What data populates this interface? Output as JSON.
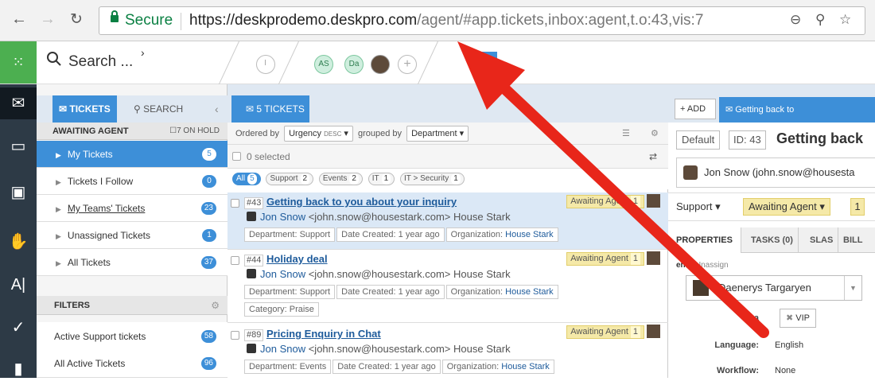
{
  "browser": {
    "secure_label": "Secure",
    "url_host": "https://deskprodemo.deskpro.com",
    "url_path": "/agent/#app.tickets,inbox:agent,t.o:43,vis:7"
  },
  "appbar": {
    "search_label": "Search ...",
    "avatars": [
      "AS",
      "Da"
    ]
  },
  "sidebar": {
    "tab_tickets": "TICKETS",
    "tab_search": "SEARCH",
    "awaiting_header": "AWAITING AGENT",
    "on_hold": "7 ON HOLD",
    "items": [
      {
        "label": "My Tickets",
        "count": "5",
        "selected": true
      },
      {
        "label": "Tickets I Follow",
        "count": "0"
      },
      {
        "label": "My Teams' Tickets",
        "count": "23"
      },
      {
        "label": "Unassigned Tickets",
        "count": "1"
      },
      {
        "label": "All Tickets",
        "count": "37"
      }
    ],
    "filters_header": "FILTERS",
    "filters": [
      {
        "label": "Active Support tickets",
        "count": "58"
      },
      {
        "label": "All Active Tickets",
        "count": "96"
      }
    ]
  },
  "list": {
    "tab_label": "5 TICKETS",
    "ordered_by": "Ordered by",
    "order_value": "Urgency",
    "order_dir": "DESC",
    "grouped_by": "grouped by",
    "group_value": "Department",
    "selected_text": "0 selected",
    "filter_pills": [
      {
        "label": "All",
        "count": "5",
        "selected": true
      },
      {
        "label": "Support",
        "count": "2"
      },
      {
        "label": "Events",
        "count": "2"
      },
      {
        "label": "IT",
        "count": "1"
      },
      {
        "label": "IT > Security",
        "count": "1"
      }
    ],
    "tickets": [
      {
        "id": "#43",
        "subject": "Getting back to you about your inquiry",
        "status": "Awaiting Agent",
        "status_count": "1",
        "person": "Jon Snow",
        "email": "<john.snow@housestark.com>",
        "org": "House Stark",
        "department": "Department: Support",
        "date": "Date Created: 1 year ago",
        "org_label": "Organization:",
        "org_value": "House Stark"
      },
      {
        "id": "#44",
        "subject": "Holiday deal",
        "status": "Awaiting Agent",
        "status_count": "1",
        "person": "Jon Snow",
        "email": "<john.snow@housestark.com>",
        "org": "House Stark",
        "department": "Department: Support",
        "date": "Date Created: 1 year ago",
        "org_label": "Organization:",
        "org_value": "House Stark",
        "category": "Category: Praise"
      },
      {
        "id": "#89",
        "subject": "Pricing Enquiry in Chat",
        "status": "Awaiting Agent",
        "status_count": "1",
        "person": "Jon Snow",
        "email": "<john.snow@housestark.com>",
        "org": "House Stark",
        "department": "Department: Events",
        "date": "Date Created: 1 year ago",
        "org_label": "Organization:",
        "org_value": "House Stark"
      }
    ]
  },
  "detail": {
    "add_label": "ADD",
    "tab_label": "Getting back to",
    "default_label": "Default",
    "id_label": "ID: 43",
    "title": "Getting back",
    "contact": "Jon Snow (john.snow@housesta",
    "department": "Support",
    "status": "Awaiting Agent",
    "status_count": "1",
    "tabs": [
      "PROPERTIES",
      "TASKS (0)",
      "SLAS",
      "BILL"
    ],
    "agent_label": "ent",
    "agent_unassign": "· Unassign",
    "agent_value": "Daenerys Targaryen",
    "labels_label": "La",
    "label_vip": "VIP",
    "language_label": "Language:",
    "language_value": "English",
    "workflow_label": "Workflow:",
    "workflow_value": "None"
  },
  "colors": {
    "accent": "#3d8fd8",
    "nav_dark": "#2d3a46",
    "status_yellow": "#f5e9a8",
    "annotation_arrow": "#e8261a"
  }
}
